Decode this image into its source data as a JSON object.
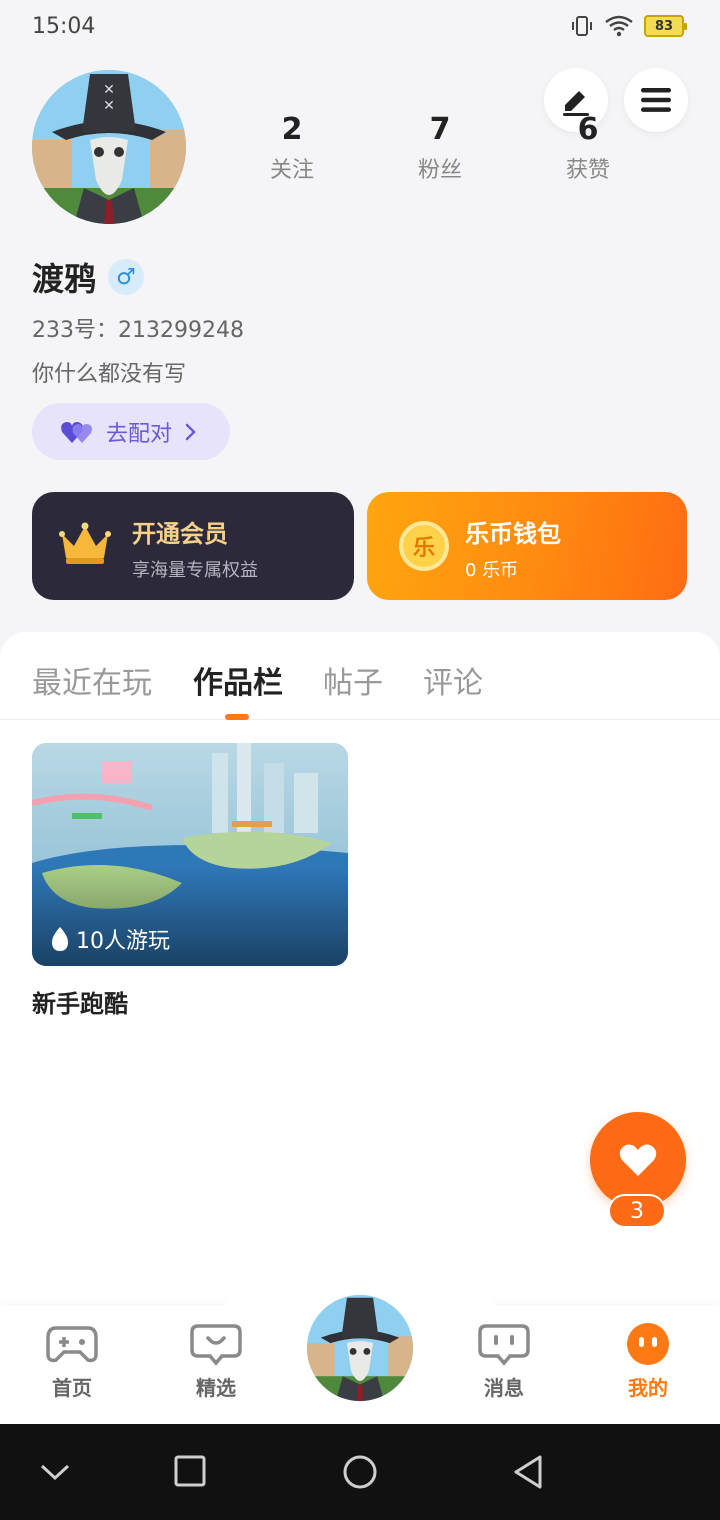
{
  "status_bar": {
    "time": "15:04",
    "battery": "83"
  },
  "profile": {
    "username": "渡鸦",
    "gender_symbol": "♂",
    "uid_text": "233号：213299248",
    "bio": "你什么都没有写",
    "match_button": "去配对"
  },
  "stats": [
    {
      "value": "2",
      "label": "关注"
    },
    {
      "value": "7",
      "label": "粉丝"
    },
    {
      "value": "6",
      "label": "获赞"
    }
  ],
  "cards": {
    "vip": {
      "title": "开通会员",
      "subtitle": "享海量专属权益"
    },
    "wallet": {
      "title": "乐币钱包",
      "subtitle": "0 乐币",
      "coin_glyph": "乐"
    }
  },
  "tabs": [
    {
      "label": "最近在玩"
    },
    {
      "label": "作品栏"
    },
    {
      "label": "帖子"
    },
    {
      "label": "评论"
    }
  ],
  "works": [
    {
      "title": "新手跑酷",
      "plays": "10人游玩"
    }
  ],
  "fab": {
    "count": "3"
  },
  "bottom_nav": [
    {
      "label": "首页",
      "icon": "gamepad-icon"
    },
    {
      "label": "精选",
      "icon": "heart-chat-icon"
    },
    {
      "label": "消息",
      "icon": "message-icon"
    },
    {
      "label": "我的",
      "icon": "face-icon"
    }
  ],
  "colors": {
    "accent": "#ff7a14",
    "vip_gold": "#f7d18a",
    "match_purple": "#6a5ad8"
  }
}
